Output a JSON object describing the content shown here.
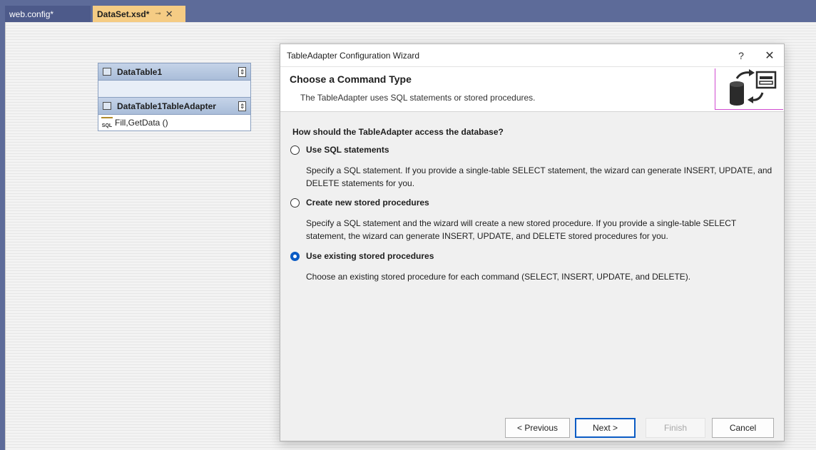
{
  "tabs": [
    {
      "label": "web.config*",
      "active": false
    },
    {
      "label": "DataSet.xsd*",
      "active": true,
      "pin_glyph": "⊸",
      "close_glyph": "✕"
    }
  ],
  "datatable": {
    "name": "DataTable1",
    "adapter_name": "DataTable1TableAdapter",
    "query": "Fill,GetData ()",
    "query_icon_text": "SQL",
    "collapse_glyph": "⇕"
  },
  "wizard": {
    "title": "TableAdapter Configuration Wizard",
    "help_glyph": "?",
    "close_glyph": "✕",
    "heading": "Choose a Command Type",
    "subheading": "The TableAdapter uses SQL statements or stored procedures.",
    "question": "How should the TableAdapter access the database?",
    "options": [
      {
        "label": "Use SQL statements",
        "checked": false,
        "description": "Specify a SQL statement. If you provide a single-table SELECT statement, the wizard can generate INSERT, UPDATE, and DELETE statements for you."
      },
      {
        "label": "Create new stored procedures",
        "checked": false,
        "description": "Specify a SQL statement and the wizard will create a new stored procedure. If you provide a single-table SELECT statement, the wizard can generate INSERT, UPDATE, and DELETE stored procedures for you."
      },
      {
        "label": "Use existing stored procedures",
        "checked": true,
        "description": "Choose an existing stored procedure for each command (SELECT, INSERT, UPDATE, and DELETE)."
      }
    ],
    "buttons": {
      "previous": "< Previous",
      "next": "Next >",
      "finish": "Finish",
      "cancel": "Cancel"
    }
  },
  "colors": {
    "tabstrip": "#5d6b99",
    "active_tab": "#f5cc84",
    "accent": "#0a5bc4",
    "banner_marker": "#d14bd1"
  }
}
